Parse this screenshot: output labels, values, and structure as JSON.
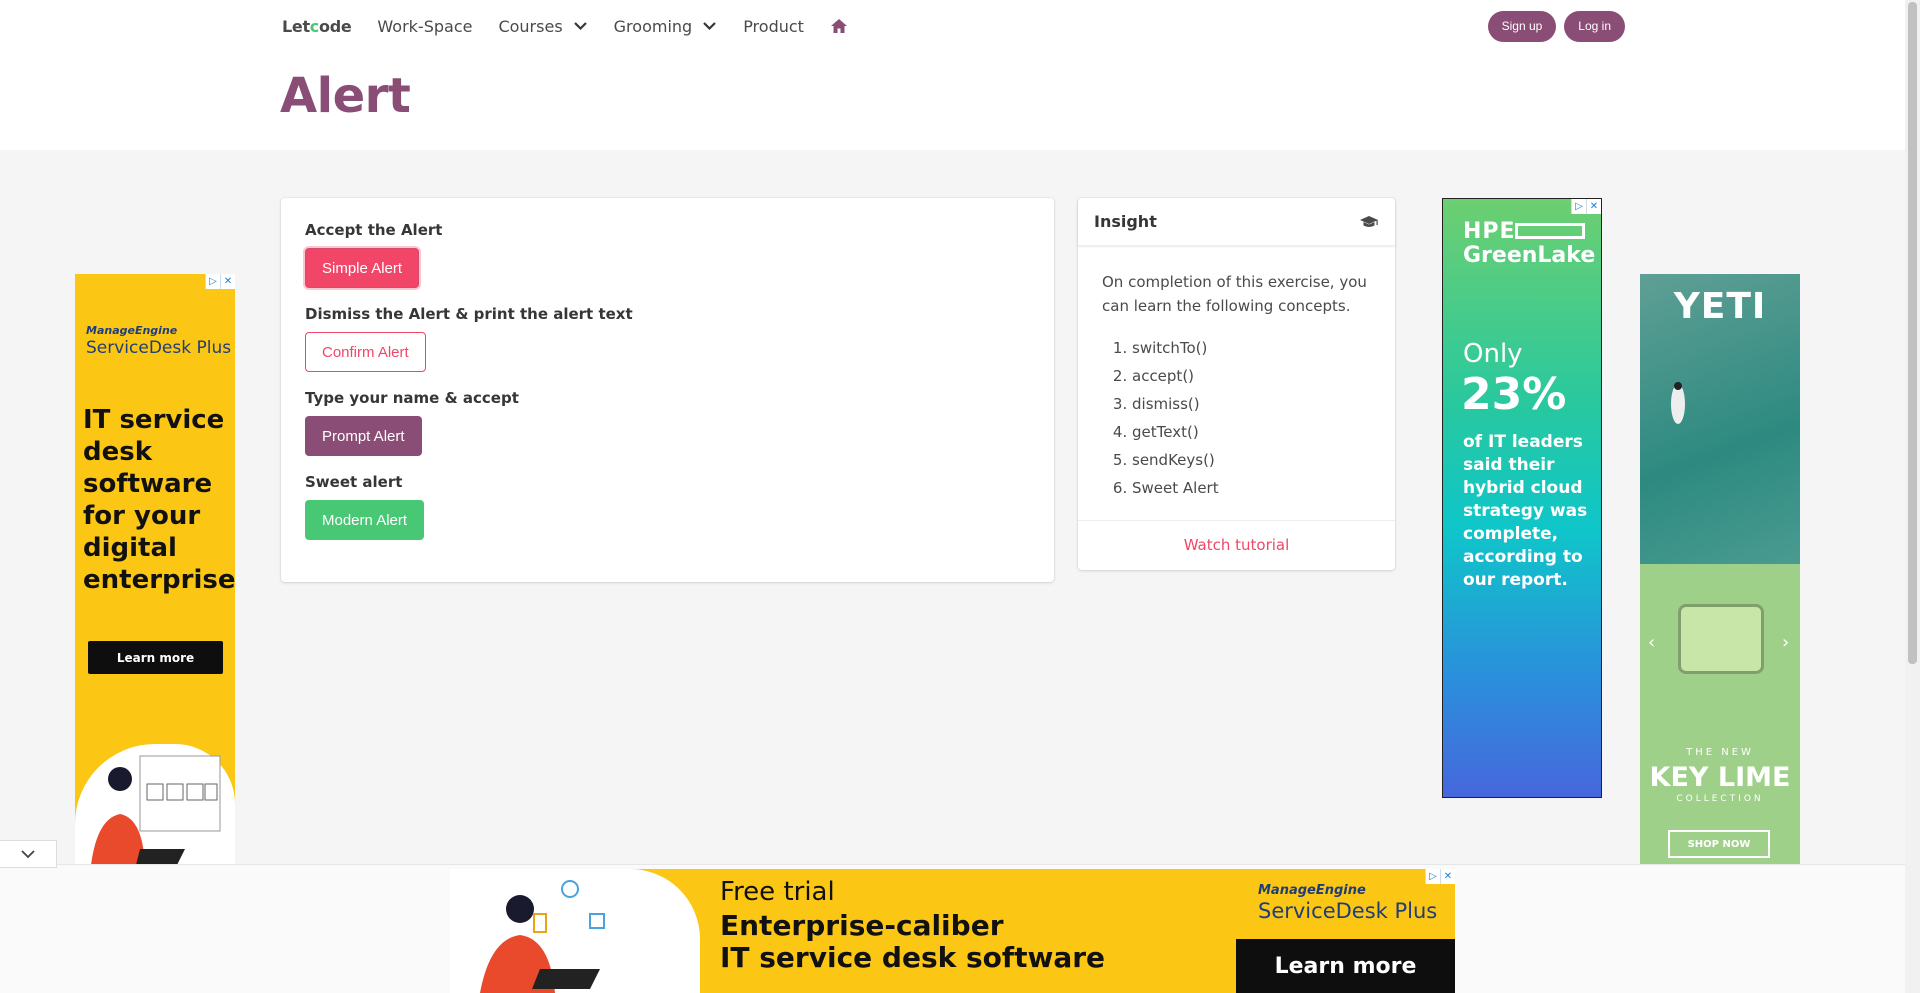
{
  "nav": {
    "brand_prefix": "Let",
    "brand_c": "c",
    "brand_o": "o",
    "brand_suffix": "de",
    "items": [
      "Work-Space",
      "Courses",
      "Grooming",
      "Product"
    ],
    "signup": "Sign up",
    "login": "Log in"
  },
  "page": {
    "title": "Alert"
  },
  "alerts": {
    "simple_label": "Accept the Alert",
    "simple_button": "Simple Alert",
    "confirm_label": "Dismiss the Alert & print the alert text",
    "confirm_button": "Confirm Alert",
    "prompt_label": "Type your name & accept",
    "prompt_button": "Prompt Alert",
    "modern_label": "Sweet alert",
    "modern_button": "Modern Alert"
  },
  "insight": {
    "title": "Insight",
    "intro": "On completion of this exercise, you can learn the following concepts.",
    "concepts": [
      "switchTo()",
      "accept()",
      "dismiss()",
      "getText()",
      "sendKeys()",
      "Sweet Alert"
    ],
    "footer_link": "Watch tutorial"
  },
  "ads": {
    "left": {
      "brand": "ManageEngine",
      "product": "ServiceDesk Plus",
      "headline": "IT service desk software for your digital enterprise",
      "cta": "Learn more"
    },
    "hpe": {
      "logo_line1": "HPE",
      "logo_line2": "GreenLake",
      "only": "Only",
      "percent": "23%",
      "text": "of IT leaders said their hybrid cloud strategy was complete, according to our report."
    },
    "yeti": {
      "logo": "YETI",
      "the_new": "THE NEW",
      "collection_name": "KEY LIME",
      "collection": "COLLECTION",
      "cta": "SHOP NOW"
    },
    "bottom": {
      "line1": "Free trial",
      "line2": "Enterprise-caliber",
      "line3": "IT service desk software",
      "brand": "ManageEngine",
      "product": "ServiceDesk Plus",
      "cta": "Learn more"
    }
  },
  "colors": {
    "primary": "#8a4d76",
    "danger": "#f14668",
    "success": "#48c774",
    "ad_yellow": "#fcc614"
  }
}
